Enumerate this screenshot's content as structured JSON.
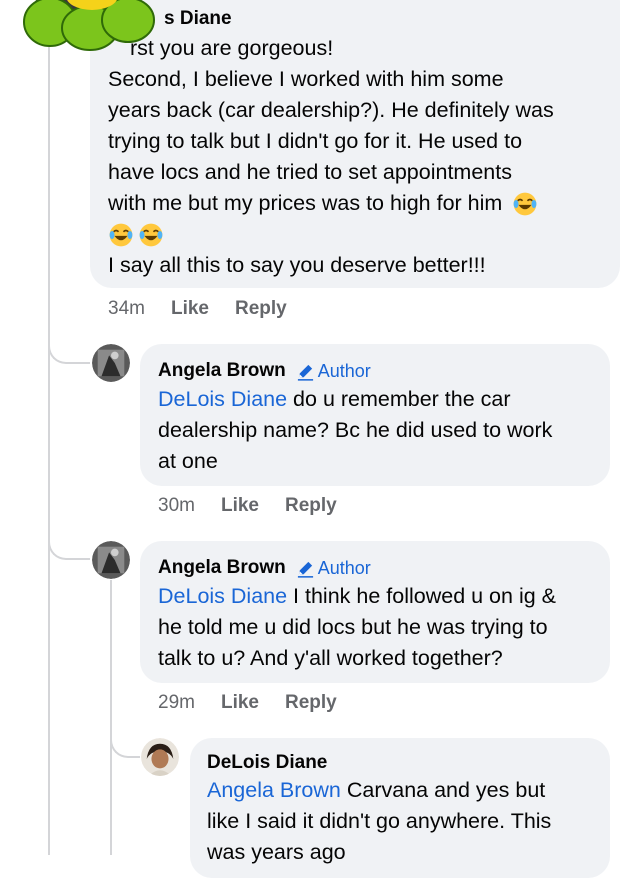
{
  "comments": [
    {
      "author": "s Diane",
      "lines": [
        "rst you are gorgeous!",
        "Second, I believe I worked with him some",
        "years back (car dealership?). He definitely was",
        "trying to talk but I didn't go for it. He used to",
        "have locs and he tried to set appointments",
        "with me but my prices was to high for him",
        "I say all this to say you deserve better!!!"
      ],
      "time": "34m",
      "like": "Like",
      "reply": "Reply"
    },
    {
      "author": "Angela Brown",
      "badge": "Author",
      "mention": "DeLois Diane",
      "line1_rest": " do u remember the car",
      "line2": "dealership name? Bc he did used to work",
      "line3": "at one",
      "time": "30m",
      "like": "Like",
      "reply": "Reply"
    },
    {
      "author": "Angela Brown",
      "badge": "Author",
      "mention": "DeLois Diane",
      "line1_rest": " I think he followed u on ig &",
      "line2": "he told me u did locs but he was trying to",
      "line3": "talk to u? And y'all worked together?",
      "time": "29m",
      "like": "Like",
      "reply": "Reply"
    },
    {
      "author": "DeLois Diane",
      "mention": "Angela Brown",
      "line1_rest": " Carvana and yes but",
      "line2": "like I said it didn't go anywhere. This",
      "line3": "was years ago"
    }
  ],
  "icons": {
    "emoji": "laughing-tears-emoji",
    "badge": "pencil-icon",
    "sticker": "green-flower-sticker"
  },
  "colors": {
    "bubble": "#f0f2f5",
    "link": "#1a66d6",
    "meta": "#65676b",
    "sticker_petal": "#7cc51c",
    "sticker_center": "#f5d21a"
  }
}
